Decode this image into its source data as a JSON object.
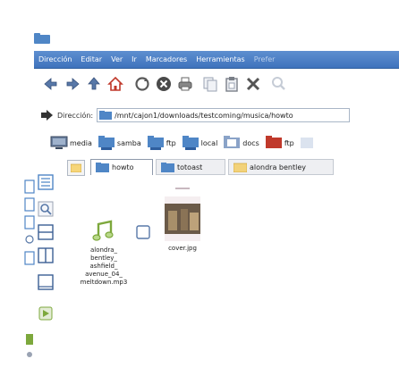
{
  "menu": [
    "Dirección",
    "Editar",
    "Ver",
    "Ir",
    "Marcadores",
    "Herramientas",
    "Prefer"
  ],
  "toolbar": {
    "icons": [
      "back-icon",
      "forward-icon",
      "up-icon",
      "home-icon",
      "reload-icon",
      "stop-icon",
      "print-icon",
      "copy-icon",
      "paste-icon",
      "delete-icon",
      "zoom-icon"
    ]
  },
  "location": {
    "label": "Dirección:",
    "value": "/mnt/cajon1/downloads/testcoming/musica/howto"
  },
  "bookmarks": [
    {
      "label": "media",
      "icon": "monitor-icon"
    },
    {
      "label": "samba",
      "icon": "network-folder-icon"
    },
    {
      "label": "ftp",
      "icon": "network-folder-icon"
    },
    {
      "label": "local",
      "icon": "network-folder-icon"
    },
    {
      "label": "docs",
      "icon": "docs-folder-icon"
    },
    {
      "label": "ftp",
      "icon": "red-folder-icon"
    }
  ],
  "tabs": [
    {
      "label": "howto",
      "active": true
    },
    {
      "label": "totoast",
      "active": false
    },
    {
      "label": "alondra bentley",
      "active": false
    }
  ],
  "files": [
    {
      "name": "alondra_ bentley_ ashfield_ avenue_04_ meltdown.mp3",
      "lines": [
        "alondra_",
        "bentley_",
        "ashfield_",
        "avenue_04_",
        "meltdown.mp3"
      ],
      "icon": "music-note-icon"
    },
    {
      "name": "cover.jpg",
      "lines": [
        "cover.jpg"
      ],
      "icon": "image-thumbnail"
    }
  ],
  "colors": {
    "menubar": "#4a7fc4",
    "folder": "#4f86c6",
    "icon_blue": "#5878a8",
    "music_green": "#7da83c"
  }
}
